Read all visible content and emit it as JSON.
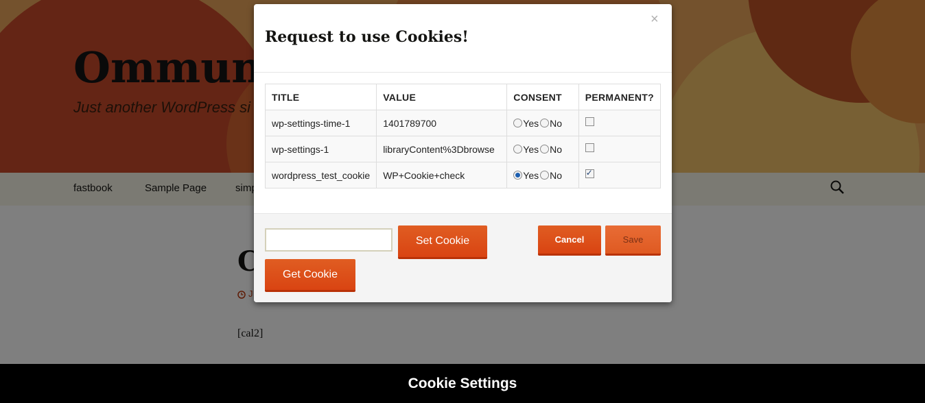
{
  "site": {
    "title": "Ommun",
    "description": "Just another WordPress si"
  },
  "nav": {
    "items": [
      "fastbook",
      "Sample Page",
      "simp"
    ]
  },
  "post": {
    "title": "C",
    "date": "J",
    "content": "[cal2]"
  },
  "modal": {
    "title": "Request to use Cookies!",
    "close_label": "×",
    "table": {
      "headers": [
        "TITLE",
        "VALUE",
        "CONSENT",
        "PERMANENT?"
      ],
      "rows": [
        {
          "title": "wp-settings-time-1",
          "value": "1401789700",
          "consent": "none",
          "permanent": false
        },
        {
          "title": "wp-settings-1",
          "value": "libraryContent%3Dbrowse",
          "consent": "none",
          "permanent": false
        },
        {
          "title": "wordpress_test_cookie",
          "value": "WP+Cookie+check",
          "consent": "yes",
          "permanent": true
        }
      ],
      "yes_label": "Yes",
      "no_label": "No"
    },
    "footer": {
      "input_value": "",
      "set_cookie_label": "Set Cookie",
      "get_cookie_label": "Get Cookie",
      "cancel_label": "Cancel",
      "save_label": "Save"
    }
  },
  "bottom_bar": {
    "label": "Cookie Settings"
  },
  "colors": {
    "accent": "#d94412",
    "bar_bg": "#000000",
    "nav_bg": "#f7f5e7"
  }
}
